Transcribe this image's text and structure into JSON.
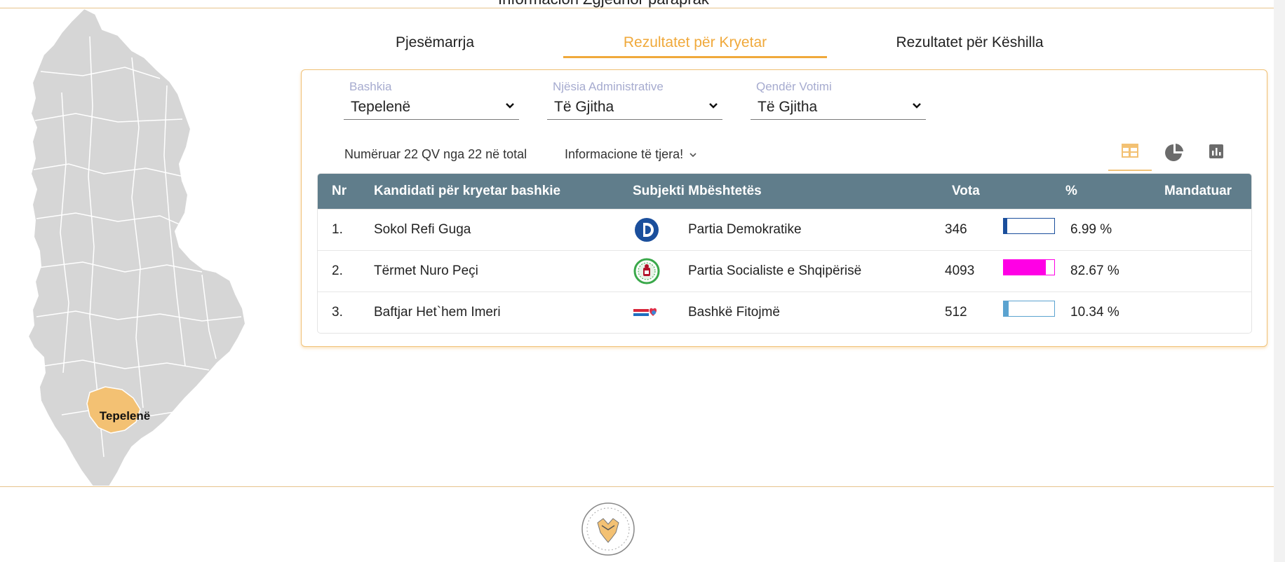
{
  "header": {
    "title": "Informacion Zgjedhor paraprak"
  },
  "map": {
    "highlighted_label": "Tepelenë",
    "highlight_color": "#f3c173",
    "base_color": "#d6d6d6"
  },
  "tabs": [
    {
      "label": "Pjesëmarrja",
      "active": false
    },
    {
      "label": "Rezultatet për Kryetar",
      "active": true
    },
    {
      "label": "Rezultatet për Këshilla",
      "active": false
    }
  ],
  "filters": [
    {
      "label": "Bashkia",
      "value": "Tepelenë"
    },
    {
      "label": "Njësia Administrative",
      "value": "Të Gjitha"
    },
    {
      "label": "Qendër Votimi",
      "value": "Të Gjitha"
    }
  ],
  "summary": {
    "counted": "Numëruar 22 QV nga 22 në total",
    "more_info": "Informacione të tjera!"
  },
  "view_buttons": [
    {
      "icon": "table-icon",
      "active": true
    },
    {
      "icon": "pie-chart-icon",
      "active": false
    },
    {
      "icon": "bar-chart-icon",
      "active": false
    }
  ],
  "table": {
    "headers": {
      "nr": "Nr",
      "candidate": "Kandidati për kryetar bashkie",
      "party": "Subjekti Mbështetës",
      "votes": "Vota",
      "percent": "%",
      "mandate": "Mandatuar"
    },
    "rows": [
      {
        "nr": "1.",
        "candidate": "Sokol Refi Guga",
        "party": "Partia Demokratike",
        "votes": "346",
        "percent": "6.99 %",
        "share": 6.99,
        "bar_color": "#1b4f9c",
        "logo": "pd-logo-icon"
      },
      {
        "nr": "2.",
        "candidate": "Tërmet Nuro Peçi",
        "party": "Partia Socialiste e Shqipërisë",
        "votes": "4093",
        "percent": "82.67 %",
        "share": 82.67,
        "bar_color": "#ff00e5",
        "logo": "ps-logo-icon"
      },
      {
        "nr": "3.",
        "candidate": "Baftjar Het`hem Imeri",
        "party": "Bashkë Fitojmë",
        "votes": "512",
        "percent": "10.34 %",
        "share": 10.34,
        "bar_color": "#5ba3d0",
        "logo": "bashke-fitojme-logo-icon"
      }
    ]
  },
  "colors": {
    "accent": "#f0a93b",
    "table_header": "#607d8b"
  }
}
